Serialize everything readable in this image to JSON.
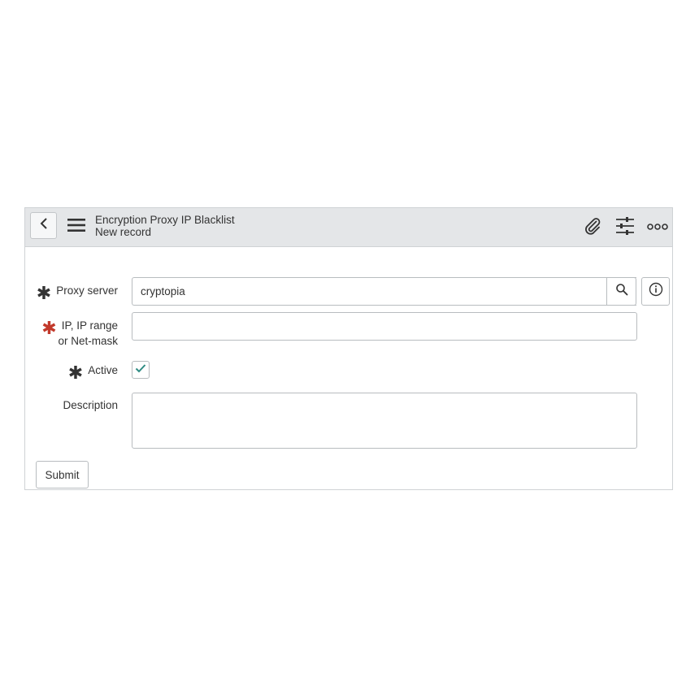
{
  "header": {
    "title": "Encryption Proxy IP Blacklist",
    "subtitle": "New record",
    "icons": {
      "back": "chevron-left-icon",
      "menu": "hamburger-menu-icon",
      "attach": "paperclip-icon",
      "settings": "sliders-icon",
      "more": "ellipsis-icon"
    }
  },
  "form": {
    "proxy_server": {
      "label": "Proxy server",
      "value": "cryptopia",
      "required_indicator": "✱"
    },
    "ip_range": {
      "label_line1": "IP, IP range",
      "label_line2": "or Net-mask",
      "value": "",
      "required_indicator": "✱"
    },
    "active": {
      "label": "Active",
      "checked": true,
      "required_indicator": "✱"
    },
    "description": {
      "label": "Description",
      "value": ""
    },
    "submit_label": "Submit"
  },
  "colors": {
    "header_bg": "#e4e6e8",
    "required_red": "#c2392b",
    "check_teal": "#2e8b83",
    "border": "#b8bcbf"
  }
}
